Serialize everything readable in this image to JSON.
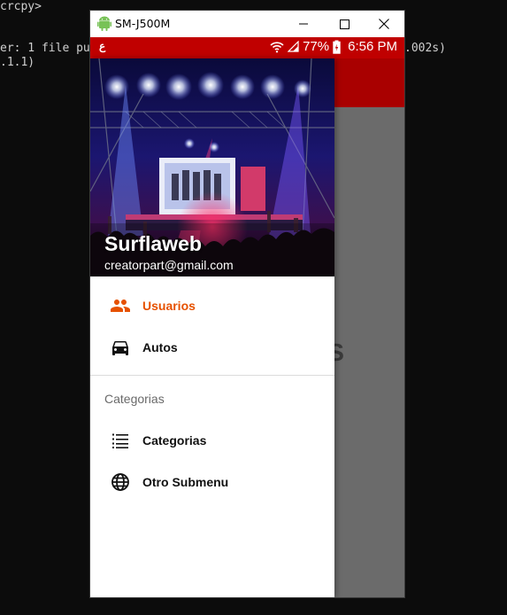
{
  "terminal": {
    "lines": [
      "crcpy>",
      "er: 1 file pu",
      ".1.1)",
      ".002s)"
    ]
  },
  "window": {
    "title": "SM-J500M",
    "icons": {
      "app": "android-icon",
      "minimize": "minimize-icon",
      "maximize": "maximize-icon",
      "close": "close-icon"
    }
  },
  "statusbar": {
    "left_glyph": "ع",
    "battery": "77%",
    "time": "6:56 PM"
  },
  "background": {
    "partial_text": "RS"
  },
  "drawer": {
    "header": {
      "name": "Surflaweb",
      "email": "creatorpart@gmail.com"
    },
    "items": [
      {
        "label": "Usuarios",
        "icon": "people-icon",
        "active": true
      },
      {
        "label": "Autos",
        "icon": "car-icon",
        "active": false
      }
    ],
    "section_title": "Categorias",
    "section_items": [
      {
        "label": "Categorias",
        "icon": "list-icon"
      },
      {
        "label": "Otro Submenu",
        "icon": "globe-icon"
      }
    ]
  },
  "colors": {
    "statusbar": "#c00000",
    "appbar": "#a90000",
    "active_item": "#e65100",
    "scrim": "#6b6b6b"
  }
}
